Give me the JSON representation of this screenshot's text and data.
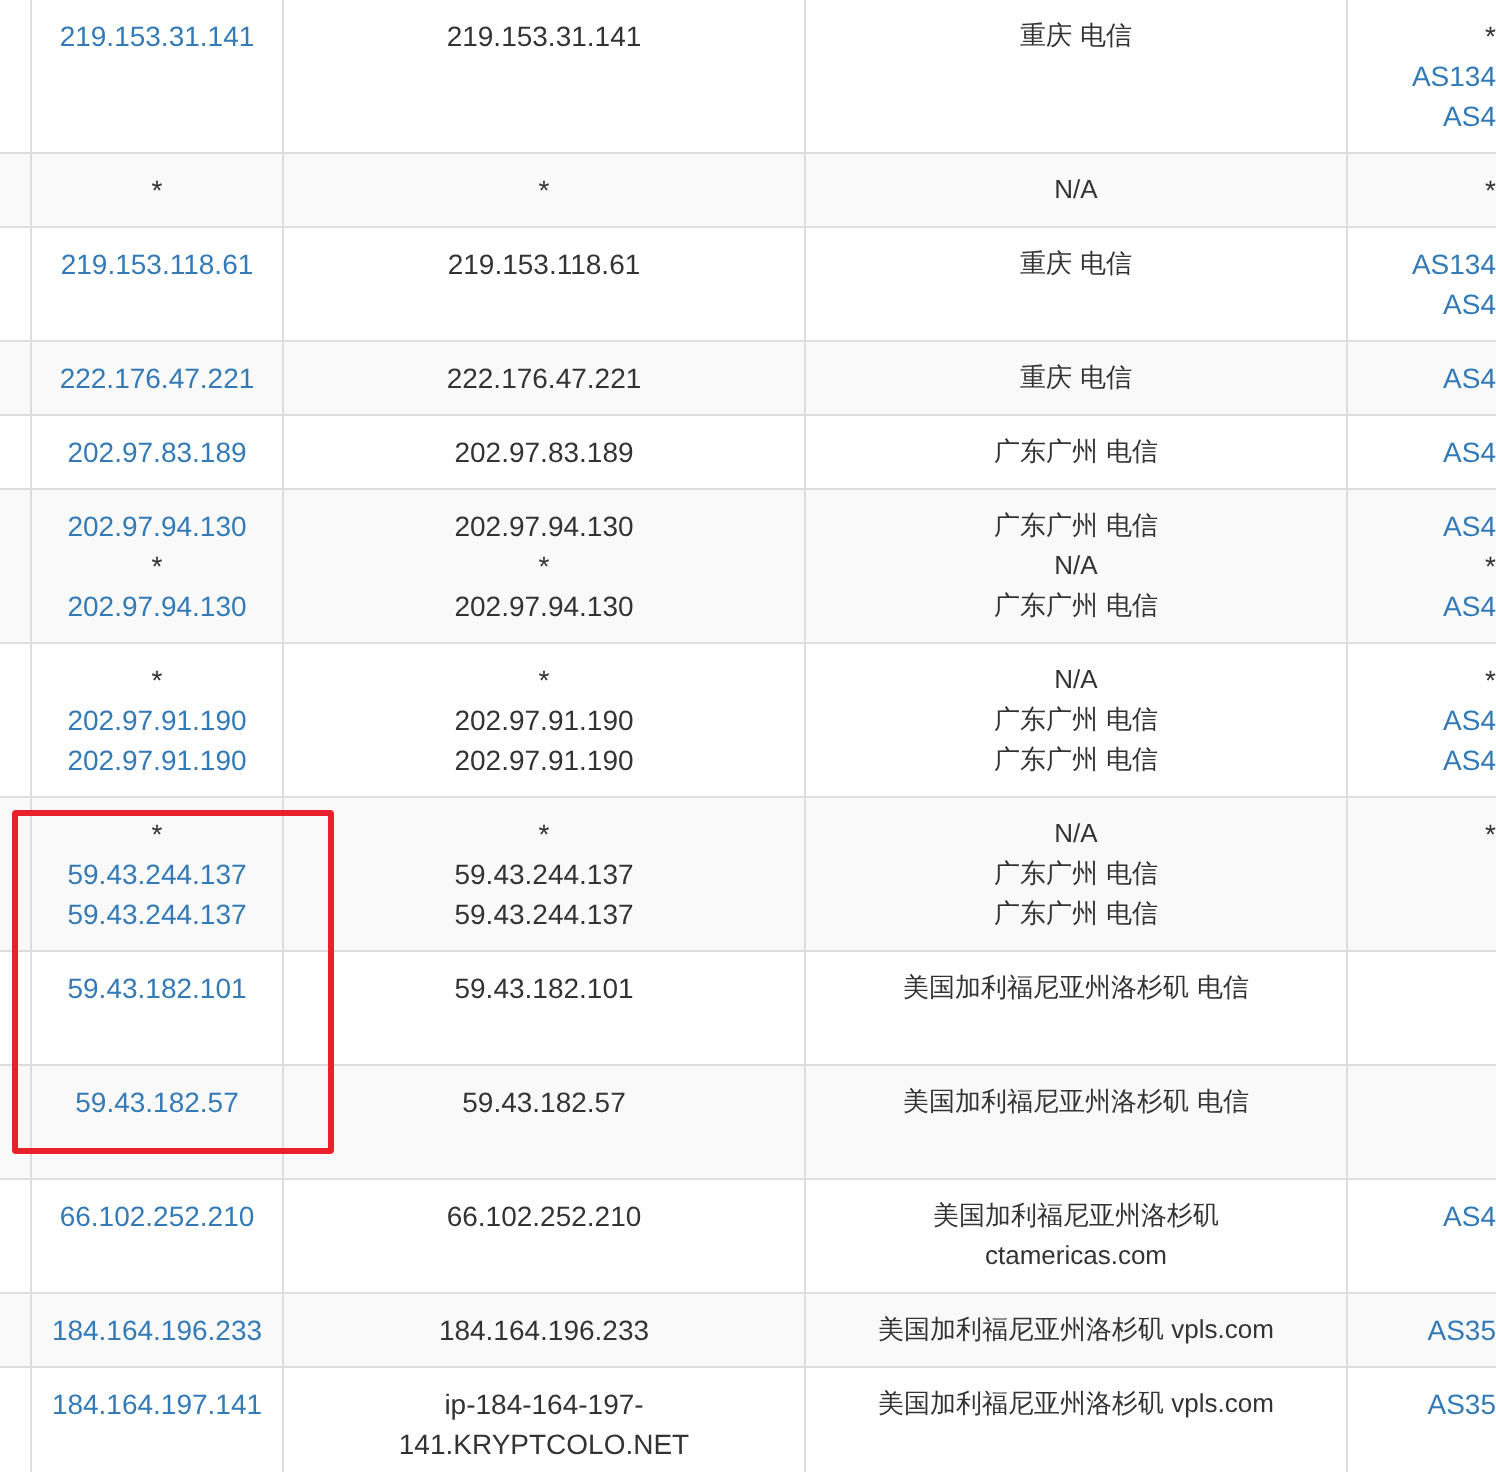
{
  "table": {
    "rows": [
      {
        "ip": [
          {
            "text": "219.153.31.141",
            "link": true
          }
        ],
        "host": [
          "219.153.31.141"
        ],
        "location": [
          "重庆 电信"
        ],
        "asn": [
          {
            "text": "*",
            "link": false
          },
          {
            "text": "AS134",
            "link": true
          },
          {
            "text": "AS4",
            "link": true
          }
        ]
      },
      {
        "ip": [
          {
            "text": "*",
            "link": false
          }
        ],
        "host": [
          "*"
        ],
        "location": [
          "N/A"
        ],
        "asn": [
          {
            "text": "*",
            "link": false
          }
        ]
      },
      {
        "ip": [
          {
            "text": "219.153.118.61",
            "link": true
          }
        ],
        "host": [
          "219.153.118.61"
        ],
        "location": [
          "重庆 电信"
        ],
        "asn": [
          {
            "text": "AS134",
            "link": true
          },
          {
            "text": "AS4",
            "link": true
          }
        ]
      },
      {
        "ip": [
          {
            "text": "222.176.47.221",
            "link": true
          }
        ],
        "host": [
          "222.176.47.221"
        ],
        "location": [
          "重庆 电信"
        ],
        "asn": [
          {
            "text": "AS4",
            "link": true
          }
        ]
      },
      {
        "ip": [
          {
            "text": "202.97.83.189",
            "link": true
          }
        ],
        "host": [
          "202.97.83.189"
        ],
        "location": [
          "广东广州 电信"
        ],
        "asn": [
          {
            "text": "AS4",
            "link": true
          }
        ]
      },
      {
        "ip": [
          {
            "text": "202.97.94.130",
            "link": true
          },
          {
            "text": "*",
            "link": false
          },
          {
            "text": "202.97.94.130",
            "link": true
          }
        ],
        "host": [
          "202.97.94.130",
          "*",
          "202.97.94.130"
        ],
        "location": [
          "广东广州 电信",
          "N/A",
          "广东广州 电信"
        ],
        "asn": [
          {
            "text": "AS4",
            "link": true
          },
          {
            "text": "*",
            "link": false
          },
          {
            "text": "AS4",
            "link": true
          }
        ]
      },
      {
        "ip": [
          {
            "text": "*",
            "link": false
          },
          {
            "text": "202.97.91.190",
            "link": true
          },
          {
            "text": "202.97.91.190",
            "link": true
          }
        ],
        "host": [
          "*",
          "202.97.91.190",
          "202.97.91.190"
        ],
        "location": [
          "N/A",
          "广东广州 电信",
          "广东广州 电信"
        ],
        "asn": [
          {
            "text": "*",
            "link": false
          },
          {
            "text": "AS4",
            "link": true
          },
          {
            "text": "AS4",
            "link": true
          }
        ]
      },
      {
        "ip": [
          {
            "text": "*",
            "link": false
          },
          {
            "text": "59.43.244.137",
            "link": true
          },
          {
            "text": "59.43.244.137",
            "link": true
          }
        ],
        "host": [
          "*",
          "59.43.244.137",
          "59.43.244.137"
        ],
        "location": [
          "N/A",
          "广东广州 电信",
          "广东广州 电信"
        ],
        "asn": [
          {
            "text": "*",
            "link": false
          }
        ]
      },
      {
        "ip": [
          {
            "text": "59.43.182.101",
            "link": true
          }
        ],
        "host": [
          "59.43.182.101"
        ],
        "location": [
          "美国加利福尼亚州洛杉矶 电信"
        ],
        "asn": []
      },
      {
        "ip": [
          {
            "text": "59.43.182.57",
            "link": true
          }
        ],
        "host": [
          "59.43.182.57"
        ],
        "location": [
          "美国加利福尼亚州洛杉矶 电信"
        ],
        "asn": []
      },
      {
        "ip": [
          {
            "text": "66.102.252.210",
            "link": true
          }
        ],
        "host": [
          "66.102.252.210"
        ],
        "location": [
          "美国加利福尼亚州洛杉矶",
          "ctamericas.com"
        ],
        "asn": [
          {
            "text": "AS4",
            "link": true
          }
        ]
      },
      {
        "ip": [
          {
            "text": "184.164.196.233",
            "link": true
          }
        ],
        "host": [
          "184.164.196.233"
        ],
        "location": [
          "美国加利福尼亚州洛杉矶 vpls.com"
        ],
        "asn": [
          {
            "text": "AS35",
            "link": true
          }
        ]
      },
      {
        "ip": [
          {
            "text": "184.164.197.141",
            "link": true
          }
        ],
        "host": [
          "ip-184-164-197-",
          "141.KRYPTCOLO.NET"
        ],
        "location": [
          "美国加利福尼亚州洛杉矶 vpls.com"
        ],
        "asn": [
          {
            "text": "AS35",
            "link": true
          }
        ]
      }
    ]
  },
  "annotation": {
    "kind": "frame"
  }
}
